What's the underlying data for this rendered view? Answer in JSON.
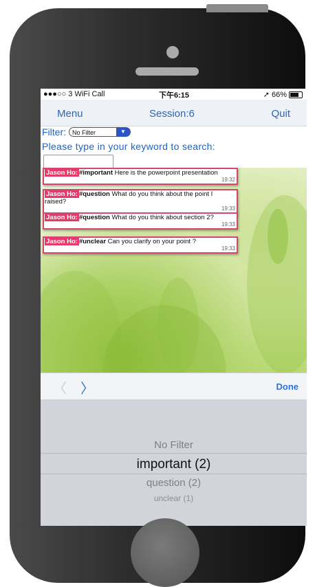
{
  "status_bar": {
    "carrier": "●●●○○ 3 WiFi Call",
    "time": "下午6:15",
    "battery": "66%"
  },
  "nav": {
    "menu": "Menu",
    "title": "Session:6",
    "quit": "Quit"
  },
  "filter": {
    "label": "Filter:",
    "selected": "No Filter"
  },
  "search": {
    "prompt": "Please type in your keyword to search:",
    "value": ""
  },
  "messages": [
    {
      "sender": "Jason Ho:",
      "tag": "#important",
      "text": " Here is the powerpoint presentation",
      "time": "19:32"
    },
    {
      "sender": "Jason Ho:",
      "tag": "#question",
      "text": " What do you think about the point I raised?",
      "time": "19:33"
    },
    {
      "sender": "Jason Ho:",
      "tag": "#question",
      "text": " What do you think about section 2?",
      "time": "19:33"
    },
    {
      "sender": "Jason Ho:",
      "tag": "#unclear",
      "text": " Can you clarify on your point ?",
      "time": "19:33"
    }
  ],
  "keyboard_bar": {
    "done": "Done"
  },
  "picker": {
    "options": [
      "No Filter",
      "important (2)",
      "question (2)",
      "unclear (1)"
    ],
    "selected_index": 1
  },
  "colors": {
    "accent": "#2f73d6",
    "sender_badge": "#e53a6a",
    "message_border": "#d4456f"
  }
}
